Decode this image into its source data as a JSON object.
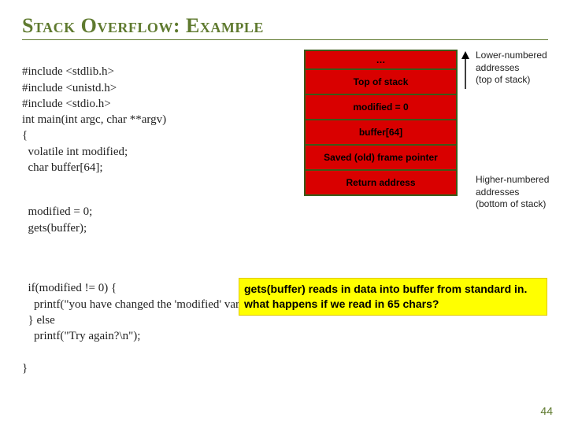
{
  "title": "Stack Overflow: Example",
  "code": {
    "l1": "#include <stdlib.h>",
    "l2": "#include <unistd.h>",
    "l3": "#include <stdio.h>",
    "l4": "int main(int argc, char **argv)",
    "l5": "{",
    "l6": "  volatile int modified;",
    "l7": "  char buffer[64];",
    "l8": "  modified = 0;",
    "l9": "  gets(buffer);",
    "l10": "  if(modified != 0) {",
    "l11": "    printf(\"you have changed the 'modified' variable\\n\");",
    "l12": "  } else",
    "l13": "    printf(\"Try again?\\n\");",
    "l14": "}"
  },
  "stack": {
    "r0": "…",
    "r1": "Top of stack",
    "r2": "modified = 0",
    "r3": "buffer[64]",
    "r4": "Saved (old) frame pointer",
    "r5": "Return address"
  },
  "labels": {
    "top": "Lower-numbered\naddresses\n(top of stack)",
    "bottom": "Higher-numbered\naddresses\n(bottom of stack)"
  },
  "note": {
    "l1": "gets(buffer) reads in data into buffer from standard in.",
    "l2": "what happens if we read in 65 chars?"
  },
  "page": "44"
}
